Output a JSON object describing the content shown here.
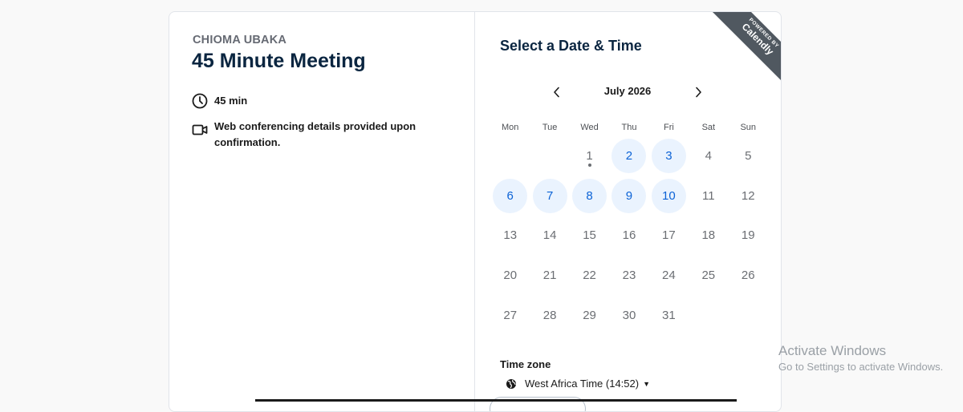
{
  "event": {
    "organizer": "CHIOMA UBAKA",
    "title": "45 Minute Meeting",
    "duration": "45 min",
    "conferencing": "Web conferencing details provided upon confirmation."
  },
  "calendar": {
    "heading": "Select a Date & Time",
    "month": "July 2026",
    "weekdays": [
      "Mon",
      "Tue",
      "Wed",
      "Thu",
      "Fri",
      "Sat",
      "Sun"
    ],
    "weeks": [
      [
        null,
        null,
        {
          "d": "1",
          "today": true
        },
        {
          "d": "2",
          "available": true
        },
        {
          "d": "3",
          "available": true
        },
        {
          "d": "4"
        },
        {
          "d": "5"
        }
      ],
      [
        {
          "d": "6",
          "available": true
        },
        {
          "d": "7",
          "available": true
        },
        {
          "d": "8",
          "available": true
        },
        {
          "d": "9",
          "available": true
        },
        {
          "d": "10",
          "available": true
        },
        {
          "d": "11"
        },
        {
          "d": "12"
        }
      ],
      [
        {
          "d": "13"
        },
        {
          "d": "14"
        },
        {
          "d": "15"
        },
        {
          "d": "16"
        },
        {
          "d": "17"
        },
        {
          "d": "18"
        },
        {
          "d": "19"
        }
      ],
      [
        {
          "d": "20"
        },
        {
          "d": "21"
        },
        {
          "d": "22"
        },
        {
          "d": "23"
        },
        {
          "d": "24"
        },
        {
          "d": "25"
        },
        {
          "d": "26"
        }
      ],
      [
        {
          "d": "27"
        },
        {
          "d": "28"
        },
        {
          "d": "29"
        },
        {
          "d": "30"
        },
        {
          "d": "31"
        },
        null,
        null
      ]
    ]
  },
  "timezone": {
    "label": "Time zone",
    "value": "West Africa Time (14:52)"
  },
  "badge": {
    "powered": "POWERED BY",
    "brand": "Calendly"
  },
  "watermark": {
    "line1": "Activate Windows",
    "line2": "Go to Settings to activate Windows."
  },
  "colors": {
    "accent": "#0b62d6",
    "available_bg": "#eaf3fe",
    "ribbon": "#505860"
  },
  "icons": {
    "duration": "clock-icon",
    "conferencing": "video-camera-icon",
    "timezone": "globe-icon",
    "prev": "chevron-left-icon",
    "next": "chevron-right-icon"
  }
}
